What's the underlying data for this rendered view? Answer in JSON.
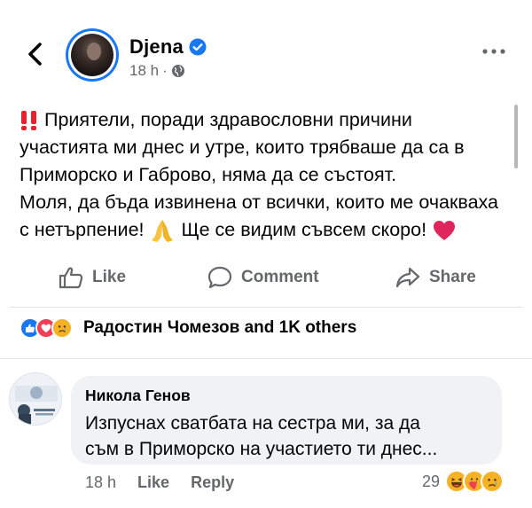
{
  "post": {
    "author": "Djena",
    "time": "18 h",
    "separator": "·",
    "lines": [
      "Приятели, поради здравословни причини",
      "участията ми днес и утре, които трябваше да са в",
      "Приморско и Габрово, няма да се състоят.",
      "Моля, да бъда извинена от всички, които ме очакваха",
      "с нетърпение!",
      "Ще се видим съвсем скоро!"
    ]
  },
  "actions": {
    "like": "Like",
    "comment": "Comment",
    "share": "Share"
  },
  "reactions": {
    "summary": "Радостин Чомезов and 1K others"
  },
  "comment": {
    "author": "Никола Генов",
    "lines": [
      "Изпуснах сватбата на сестра ми, за да",
      "съм в Приморско на участието ти днес..."
    ],
    "time": "18 h",
    "like": "Like",
    "reply": "Reply",
    "reaction_count": "29"
  },
  "colors": {
    "brand_blue": "#1877f2",
    "secondary_text": "#65676b",
    "bubble_bg": "#f0f2f5",
    "heart": "#e0245e",
    "exclamation": "#e8212e"
  }
}
